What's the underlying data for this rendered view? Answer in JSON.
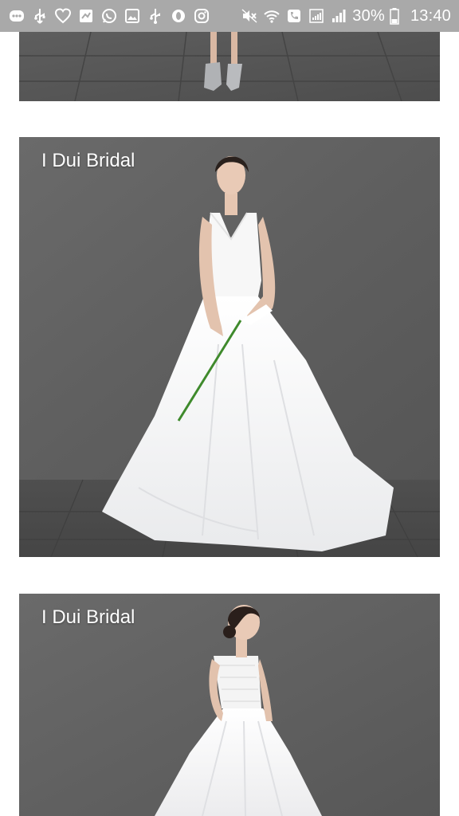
{
  "status_bar": {
    "battery_percent": "30%",
    "time": "13:40",
    "left_icons": [
      "message-icon",
      "usb-icon",
      "heart-icon",
      "app-icon",
      "whatsapp-icon",
      "gallery-icon",
      "usb-icon",
      "notification-icon",
      "instagram-icon"
    ],
    "right_icons": [
      "mute-icon",
      "wifi-icon",
      "phone-icon",
      "data-signal-icon",
      "signal-icon",
      "battery-icon"
    ]
  },
  "gallery": {
    "photos": [
      {
        "label": ""
      },
      {
        "label": "I Dui Bridal"
      },
      {
        "label": "I Dui Bridal"
      }
    ]
  }
}
